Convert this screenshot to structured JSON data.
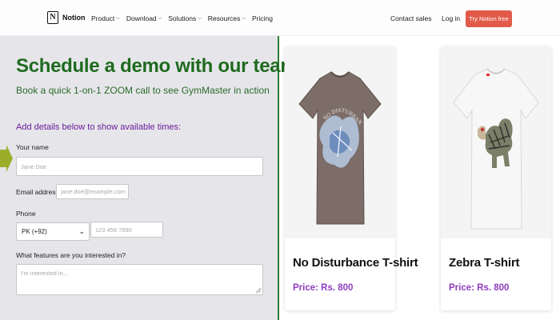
{
  "brand": {
    "logo_glyph": "N",
    "name": "Notion"
  },
  "nav": {
    "items": [
      {
        "label": "Product",
        "has_dropdown": true
      },
      {
        "label": "Download",
        "has_dropdown": true
      },
      {
        "label": "Solutions",
        "has_dropdown": true
      },
      {
        "label": "Resources",
        "has_dropdown": true
      },
      {
        "label": "Pricing",
        "has_dropdown": false
      }
    ],
    "contact_sales": "Contact sales",
    "login": "Log in",
    "cta": "Try Notion free"
  },
  "form": {
    "title": "Schedule a demo with our team",
    "subtitle": "Book a quick 1-on-1 ZOOM call to see GymMaster in action",
    "section_heading": "Add details below to show available times:",
    "name": {
      "label": "Your name",
      "placeholder": "Jane Doe",
      "value": ""
    },
    "email": {
      "label": "Email address",
      "placeholder": "jane.doe@example.com",
      "value": ""
    },
    "phone": {
      "label": "Phone",
      "country": "PK (+92)",
      "placeholder": "123 456 7890",
      "value": ""
    },
    "features": {
      "label": "What features are you interested in?",
      "placeholder": "I'm interested in...",
      "value": ""
    }
  },
  "products": [
    {
      "name": "No Disturbance T-shirt",
      "price": "Price: Rs. 800",
      "shirt_color": "#7c6d68",
      "print_text": "NO DISTURBANCE"
    },
    {
      "name": "Zebra T-shirt",
      "price": "Price: Rs. 800",
      "shirt_color": "#f7f7f7"
    }
  ],
  "colors": {
    "title_green": "#1f6b1f",
    "section_purple": "#6a1b9a",
    "price_purple": "#8e3cc0",
    "cta_red": "#e25b4a",
    "arrow_green": "#9aae2a"
  }
}
